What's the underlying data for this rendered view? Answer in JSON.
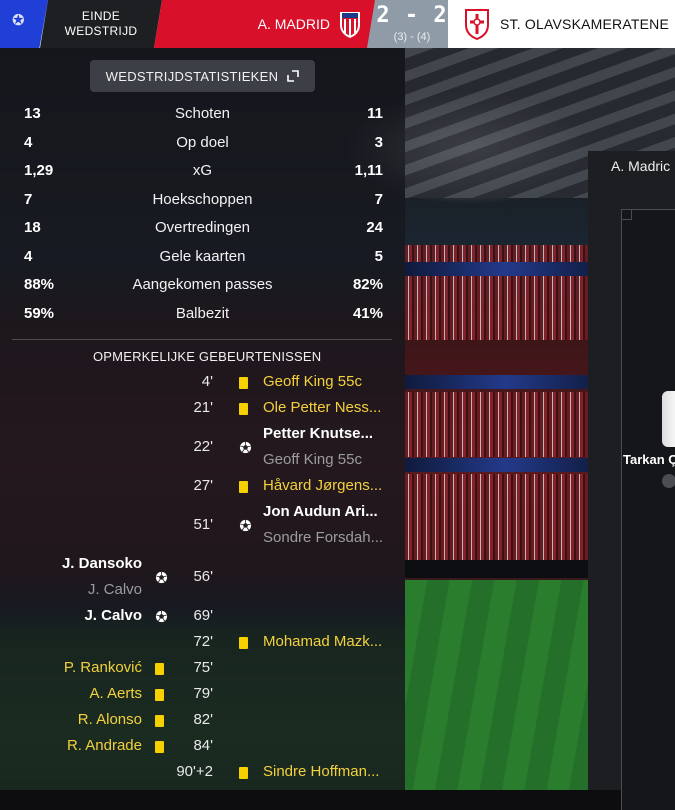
{
  "header": {
    "status_line1": "EINDE",
    "status_line2": "WEDSTRIJD",
    "home_team": "A. MADRID",
    "score": "2 - 2",
    "penalties": "(3) - (4)",
    "away_team": "ST. OLAVSKAMERATENE",
    "home_color": "#d8102a",
    "competition_color": "#1f3fd6"
  },
  "stats_button": {
    "label": "WEDSTRIJDSTATISTIEKEN",
    "icon": "external-link-icon"
  },
  "stats": [
    {
      "label": "Schoten",
      "home": "13",
      "away": "11"
    },
    {
      "label": "Op doel",
      "home": "4",
      "away": "3"
    },
    {
      "label": "xG",
      "home": "1,29",
      "away": "1,11"
    },
    {
      "label": "Hoekschoppen",
      "home": "7",
      "away": "7"
    },
    {
      "label": "Overtredingen",
      "home": "18",
      "away": "24"
    },
    {
      "label": "Gele kaarten",
      "home": "4",
      "away": "5"
    },
    {
      "label": "Aangekomen passes",
      "home": "88%",
      "away": "82%"
    },
    {
      "label": "Balbezit",
      "home": "59%",
      "away": "41%"
    }
  ],
  "events_title": "OPMERKELIJKE GEBEURTENISSEN",
  "events": [
    {
      "minute": "4'",
      "side": "away",
      "type": "yellow-card",
      "name": "Geoff King 55c"
    },
    {
      "minute": "21'",
      "side": "away",
      "type": "yellow-card",
      "name": "Ole Petter Ness..."
    },
    {
      "minute": "22'",
      "side": "away",
      "type": "goal",
      "name": "Petter Knutse...",
      "assist": "Geoff King 55c"
    },
    {
      "minute": "27'",
      "side": "away",
      "type": "yellow-card",
      "name": "Håvard Jørgens..."
    },
    {
      "minute": "51'",
      "side": "away",
      "type": "goal",
      "name": "Jon Audun Ari...",
      "assist": "Sondre Forsdah..."
    },
    {
      "minute": "56'",
      "side": "home",
      "type": "goal",
      "name": "J. Dansoko",
      "assist": "J. Calvo"
    },
    {
      "minute": "69'",
      "side": "home",
      "type": "goal",
      "name": "J. Calvo"
    },
    {
      "minute": "72'",
      "side": "away",
      "type": "yellow-card",
      "name": "Mohamad Mazk..."
    },
    {
      "minute": "75'",
      "side": "home",
      "type": "yellow-card",
      "name": "P. Ranković"
    },
    {
      "minute": "79'",
      "side": "home",
      "type": "yellow-card",
      "name": "A. Aerts"
    },
    {
      "minute": "82'",
      "side": "home",
      "type": "yellow-card",
      "name": "R. Alonso"
    },
    {
      "minute": "84'",
      "side": "home",
      "type": "yellow-card",
      "name": "R. Andrade"
    },
    {
      "minute": "90'+2",
      "side": "away",
      "type": "yellow-card",
      "name": "Sindre Hoffman..."
    }
  ],
  "tactics": {
    "title": "A. Madric",
    "player": "Tarkan Ç"
  }
}
